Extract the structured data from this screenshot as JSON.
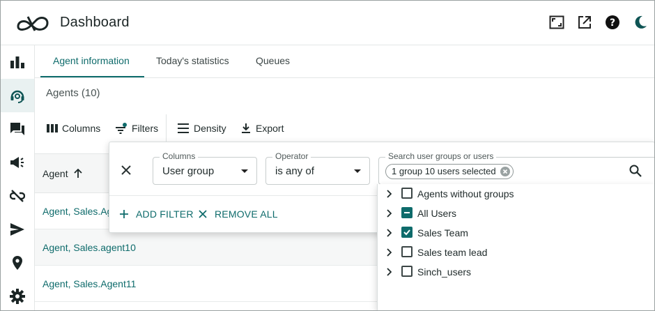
{
  "app": {
    "title": "Dashboard"
  },
  "top_icons": [
    "fullscreen-icon",
    "open-external-icon",
    "help-icon",
    "dark-mode-icon"
  ],
  "rail": [
    "bar-chart-icon",
    "agent-headset-icon",
    "chat-icon",
    "announcement-icon",
    "unlink-icon",
    "send-icon",
    "location-pin-icon",
    "settings-gear-icon"
  ],
  "tabs": [
    {
      "label": "Agent information",
      "active": true
    },
    {
      "label": "Today's statistics",
      "active": false
    },
    {
      "label": "Queues",
      "active": false
    }
  ],
  "agents_title": "Agents (10)",
  "toolbar": {
    "columns": "Columns",
    "filters": "Filters",
    "density": "Density",
    "export": "Export"
  },
  "grid": {
    "header": "Agent",
    "rows": [
      "Agent, Sales.Ag",
      "Agent, Sales.agent10",
      "Agent, Sales.Agent11"
    ]
  },
  "filter": {
    "columns_label": "Columns",
    "columns_value": "User group",
    "operator_label": "Operator",
    "operator_value": "is any of",
    "search_label": "Search user groups or users",
    "chip": "1 group 10 users selected",
    "add_filter": "ADD FILTER",
    "remove_all": "REMOVE ALL"
  },
  "tree": [
    {
      "label": "Agents without groups",
      "state": "unchecked"
    },
    {
      "label": "All Users",
      "state": "indeterminate"
    },
    {
      "label": "Sales Team",
      "state": "checked"
    },
    {
      "label": "Sales team lead",
      "state": "unchecked"
    },
    {
      "label": "Sinch_users",
      "state": "unchecked"
    }
  ],
  "colors": {
    "accent": "#0e6b6b",
    "text": "#1f2a2a"
  }
}
